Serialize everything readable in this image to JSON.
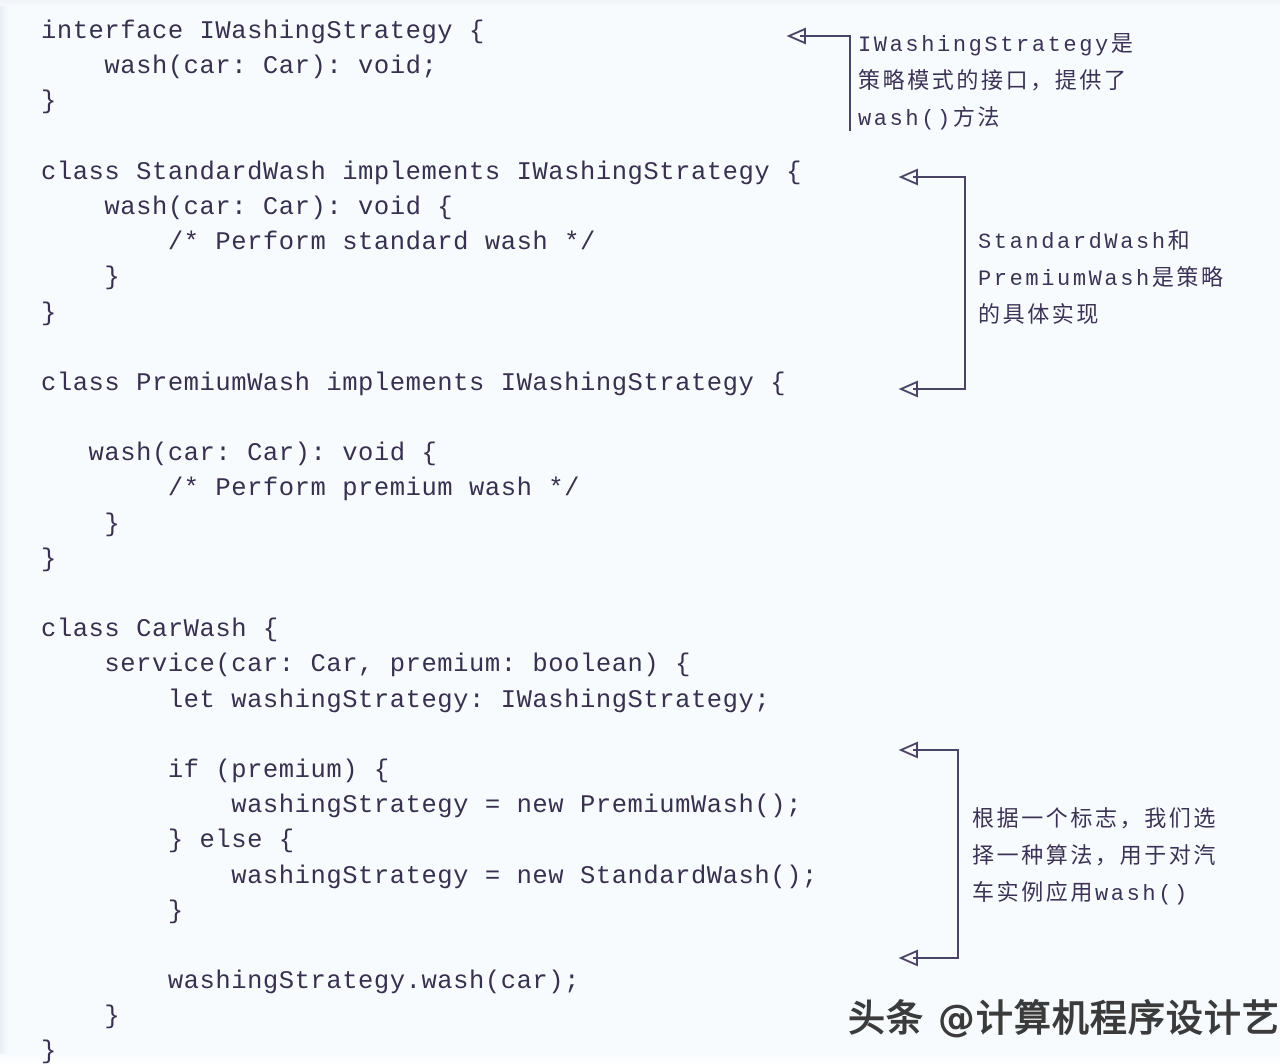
{
  "page": {
    "background_color": "#f8fbfd",
    "code_text_color": "#37304e",
    "annotation_text_color": "#3b3356",
    "connector_color": "#4a4464"
  },
  "code": {
    "language": "typescript",
    "lines": [
      "interface IWashingStrategy {",
      "    wash(car: Car): void;",
      "}",
      "",
      "class StandardWash implements IWashingStrategy {",
      "    wash(car: Car): void {",
      "        /* Perform standard wash */",
      "    }",
      "}",
      "",
      "class PremiumWash implements IWashingStrategy {",
      "",
      "   wash(car: Car): void {",
      "        /* Perform premium wash */",
      "    }",
      "}",
      "",
      "class CarWash {",
      "    service(car: Car, premium: boolean) {",
      "        let washingStrategy: IWashingStrategy;",
      "",
      "        if (premium) {",
      "            washingStrategy = new PremiumWash();",
      "        } else {",
      "            washingStrategy = new StandardWash();",
      "        }",
      "",
      "        washingStrategy.wash(car);",
      "    }",
      "}"
    ]
  },
  "annotations": [
    {
      "id": "annot-1",
      "text": "IWashingStrategy是\n策略模式的接口，提供了\nwash()方法",
      "target_label": "interface-iwashingstrategy"
    },
    {
      "id": "annot-2",
      "text": "StandardWash和\nPremiumWash是策略\n的具体实现",
      "target_label": "strategy-implementations"
    },
    {
      "id": "annot-3",
      "text": "根据一个标志，我们选\n择一种算法，用于对汽\n车实例应用wash()",
      "target_label": "strategy-selection-and-invocation"
    }
  ],
  "watermark": {
    "text": "头条 @计算机程序设计艺术"
  }
}
